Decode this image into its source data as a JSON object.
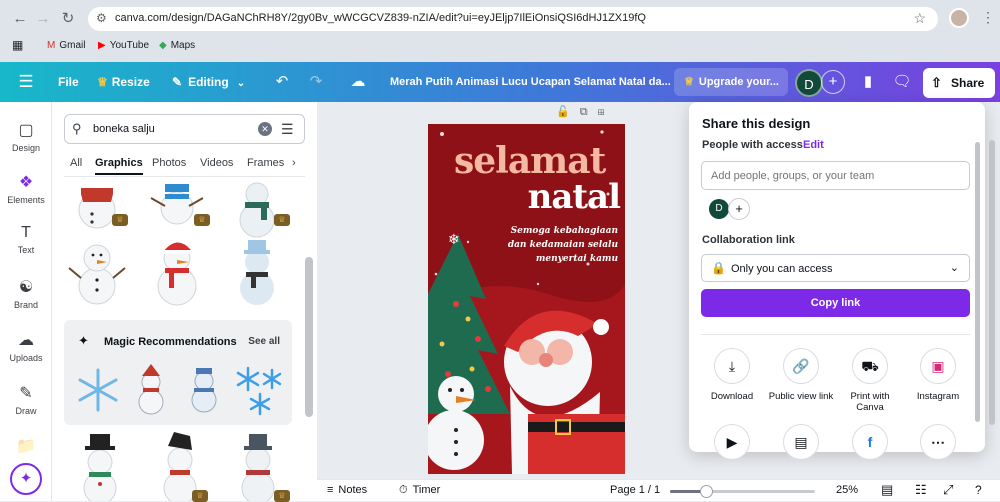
{
  "browser": {
    "url": "canva.com/design/DAGaNChRH8Y/2gy0Bv_wWCGCVZ839-nZIA/edit?ui=eyJEljp7IlEiOnsiQSI6dHJ1ZX19fQ",
    "bookmarks": [
      "Gmail",
      "YouTube",
      "Maps"
    ]
  },
  "header": {
    "file": "File",
    "resize": "Resize",
    "editing": "Editing",
    "doc_title": "Merah Putih Animasi Lucu Ucapan Selamat Natal da...",
    "upgrade": "Upgrade your...",
    "avatar": "D",
    "share": "Share"
  },
  "rail": [
    {
      "label": "Design",
      "icon": "design-icon"
    },
    {
      "label": "Elements",
      "icon": "elements-icon"
    },
    {
      "label": "Text",
      "icon": "text-icon"
    },
    {
      "label": "Brand",
      "icon": "brand-icon"
    },
    {
      "label": "Uploads",
      "icon": "uploads-icon"
    },
    {
      "label": "Draw",
      "icon": "draw-icon"
    }
  ],
  "panel": {
    "search_value": "boneka salju",
    "tabs": [
      "All",
      "Graphics",
      "Photos",
      "Videos",
      "Frames"
    ],
    "active_tab": "Graphics",
    "magic_title": "Magic Recommendations",
    "see_all": "See all"
  },
  "card": {
    "line1": "selamat",
    "line2": "natal",
    "message": [
      "Semoga kebahagiaan",
      "dan kedamaian selalu",
      "menyertai kamu"
    ]
  },
  "share": {
    "title": "Share this design",
    "people_label": "People with access",
    "edit": "Edit",
    "add_placeholder": "Add people, groups, or your team",
    "avatar": "D",
    "collab_label": "Collaboration link",
    "access_value": "Only you can access",
    "copy_link": "Copy link",
    "options": [
      {
        "label": "Download",
        "icon": "download-icon"
      },
      {
        "label": "Public view link",
        "icon": "link-icon"
      },
      {
        "label": "Print with Canva",
        "icon": "truck-icon"
      },
      {
        "label": "Instagram",
        "icon": "instagram-icon"
      }
    ]
  },
  "footer": {
    "notes": "Notes",
    "timer": "Timer",
    "page": "Page 1 / 1",
    "zoom": "25%",
    "zoom_fraction": 0.25
  },
  "colors": {
    "accent": "#7d2ae8",
    "card_red": "#8e1117",
    "header_gradient_start": "#17b8c9",
    "header_gradient_end": "#7a3fe0"
  }
}
